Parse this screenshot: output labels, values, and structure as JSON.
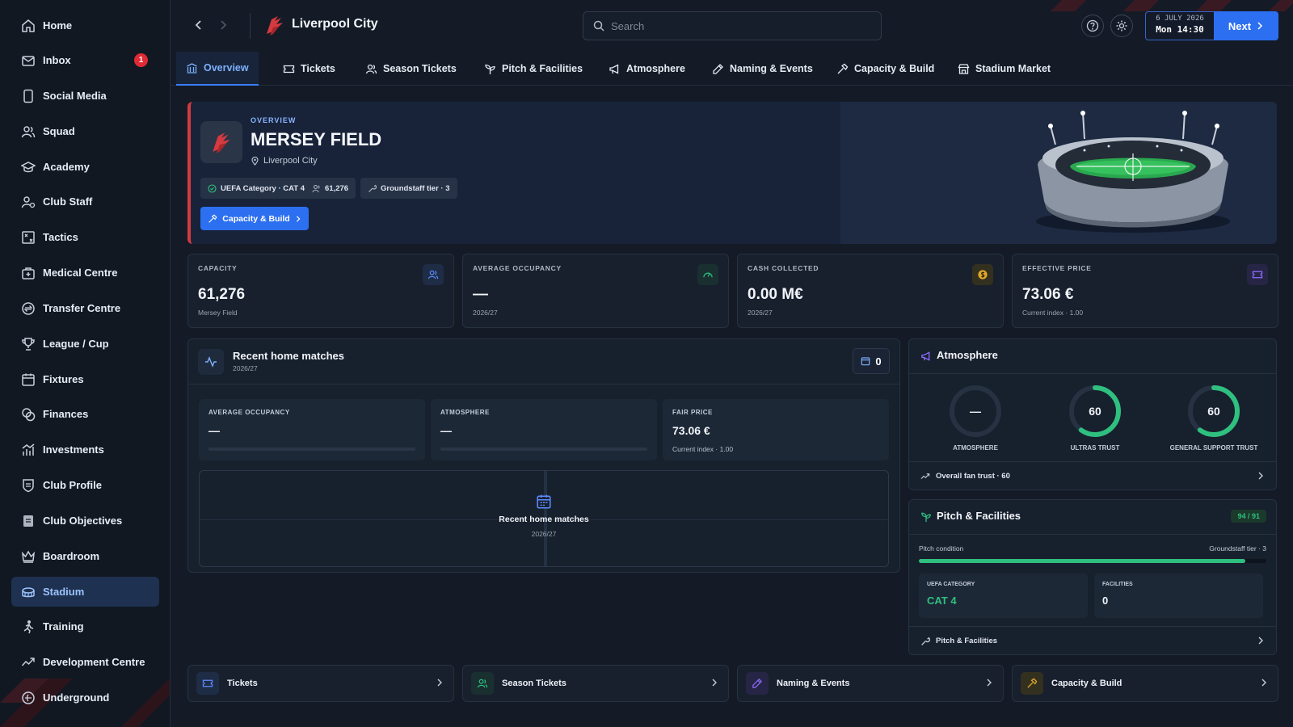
{
  "sidebar": {
    "items": [
      {
        "label": "Home",
        "icon": "home-icon"
      },
      {
        "label": "Inbox",
        "icon": "mail-icon",
        "badge": "1"
      },
      {
        "label": "Social Media",
        "icon": "phone-icon"
      },
      {
        "label": "Squad",
        "icon": "users-icon"
      },
      {
        "label": "Academy",
        "icon": "graduation-cap-icon"
      },
      {
        "label": "Club Staff",
        "icon": "staff-icon"
      },
      {
        "label": "Tactics",
        "icon": "tactics-board-icon"
      },
      {
        "label": "Medical Centre",
        "icon": "medical-icon"
      },
      {
        "label": "Transfer Centre",
        "icon": "transfer-icon"
      },
      {
        "label": "League / Cup",
        "icon": "trophy-icon"
      },
      {
        "label": "Fixtures",
        "icon": "calendar-icon"
      },
      {
        "label": "Finances",
        "icon": "coins-icon"
      },
      {
        "label": "Investments",
        "icon": "chart-icon"
      },
      {
        "label": "Club Profile",
        "icon": "club-profile-icon"
      },
      {
        "label": "Club Objectives",
        "icon": "objectives-icon"
      },
      {
        "label": "Boardroom",
        "icon": "crown-icon"
      },
      {
        "label": "Stadium",
        "icon": "stadium-icon",
        "active": true
      },
      {
        "label": "Training",
        "icon": "training-icon"
      },
      {
        "label": "Development Centre",
        "icon": "trend-up-icon"
      },
      {
        "label": "Underground",
        "icon": "underground-icon"
      }
    ]
  },
  "header": {
    "club_name": "Liverpool City",
    "search_placeholder": "Search",
    "date_line": "6 JULY 2026",
    "time_line": "Mon 14:30",
    "next_label": "Next"
  },
  "tabs": [
    {
      "label": "Overview",
      "active": true
    },
    {
      "label": "Tickets"
    },
    {
      "label": "Season Tickets"
    },
    {
      "label": "Pitch & Facilities"
    },
    {
      "label": "Atmosphere"
    },
    {
      "label": "Naming & Events"
    },
    {
      "label": "Capacity & Build"
    },
    {
      "label": "Stadium Market"
    }
  ],
  "hero": {
    "eyebrow": "OVERVIEW",
    "title": "MERSEY FIELD",
    "location": "Liverpool City",
    "pills": [
      "UEFA Category · CAT 4",
      "61,276",
      "Groundstaff tier · 3"
    ],
    "button_label": "Capacity & Build"
  },
  "kpis": [
    {
      "label": "CAPACITY",
      "value": "61,276",
      "sub": "Mersey Field",
      "icon": "users-icon",
      "accent": "#5b8cff"
    },
    {
      "label": "AVERAGE OCCUPANCY",
      "value": "—",
      "sub": "2026/27",
      "icon": "gauge-icon",
      "accent": "#2fbf7f"
    },
    {
      "label": "CASH COLLECTED",
      "value": "0.00 M€",
      "sub": "2026/27",
      "icon": "coin-icon",
      "accent": "#e0a52c"
    },
    {
      "label": "EFFECTIVE PRICE",
      "value": "73.06 €",
      "sub": "Current index · 1.00",
      "icon": "ticket-icon",
      "accent": "#8f6cff"
    }
  ],
  "recent_matches": {
    "title": "Recent home matches",
    "season": "2026/27",
    "count": "0",
    "cards": [
      {
        "label": "AVERAGE OCCUPANCY",
        "value": "—"
      },
      {
        "label": "ATMOSPHERE",
        "value": "—"
      },
      {
        "label": "FAIR PRICE",
        "value": "73.06 €",
        "sub": "Current index · 1.00"
      }
    ],
    "empty_title": "Recent home matches",
    "empty_sub": "2026/27"
  },
  "atmosphere": {
    "title": "Atmosphere",
    "gauges": [
      {
        "label": "ATMOSPHERE",
        "value": "—",
        "level": 0
      },
      {
        "label": "ULTRAS TRUST",
        "value": "60",
        "level": 0.6
      },
      {
        "label": "GENERAL SUPPORT TRUST",
        "value": "60",
        "level": 0.6
      }
    ],
    "footer": "Overall fan trust · 60"
  },
  "pitch": {
    "title": "Pitch & Facilities",
    "score": "94 / 91",
    "condition_label": "Pitch condition",
    "groundstaff_label": "Groundstaff tier · 3",
    "condition_level": 0.94,
    "uefa_label": "UEFA CATEGORY",
    "uefa_value": "CAT 4",
    "facilities_label": "FACILITIES",
    "facilities_value": "0",
    "footer": "Pitch & Facilities"
  },
  "bottom_links": [
    {
      "label": "Tickets",
      "icon": "ticket-icon",
      "accent": "#5b8cff"
    },
    {
      "label": "Season Tickets",
      "icon": "users-icon",
      "accent": "#2fbf7f"
    },
    {
      "label": "Naming & Events",
      "icon": "pen-icon",
      "accent": "#8f6cff"
    },
    {
      "label": "Capacity & Build",
      "icon": "hammer-icon",
      "accent": "#e0a52c"
    }
  ],
  "colors": {
    "accent_blue": "#2c6ff0",
    "success_green": "#2fbf7f",
    "club_red": "#d43a3f"
  }
}
